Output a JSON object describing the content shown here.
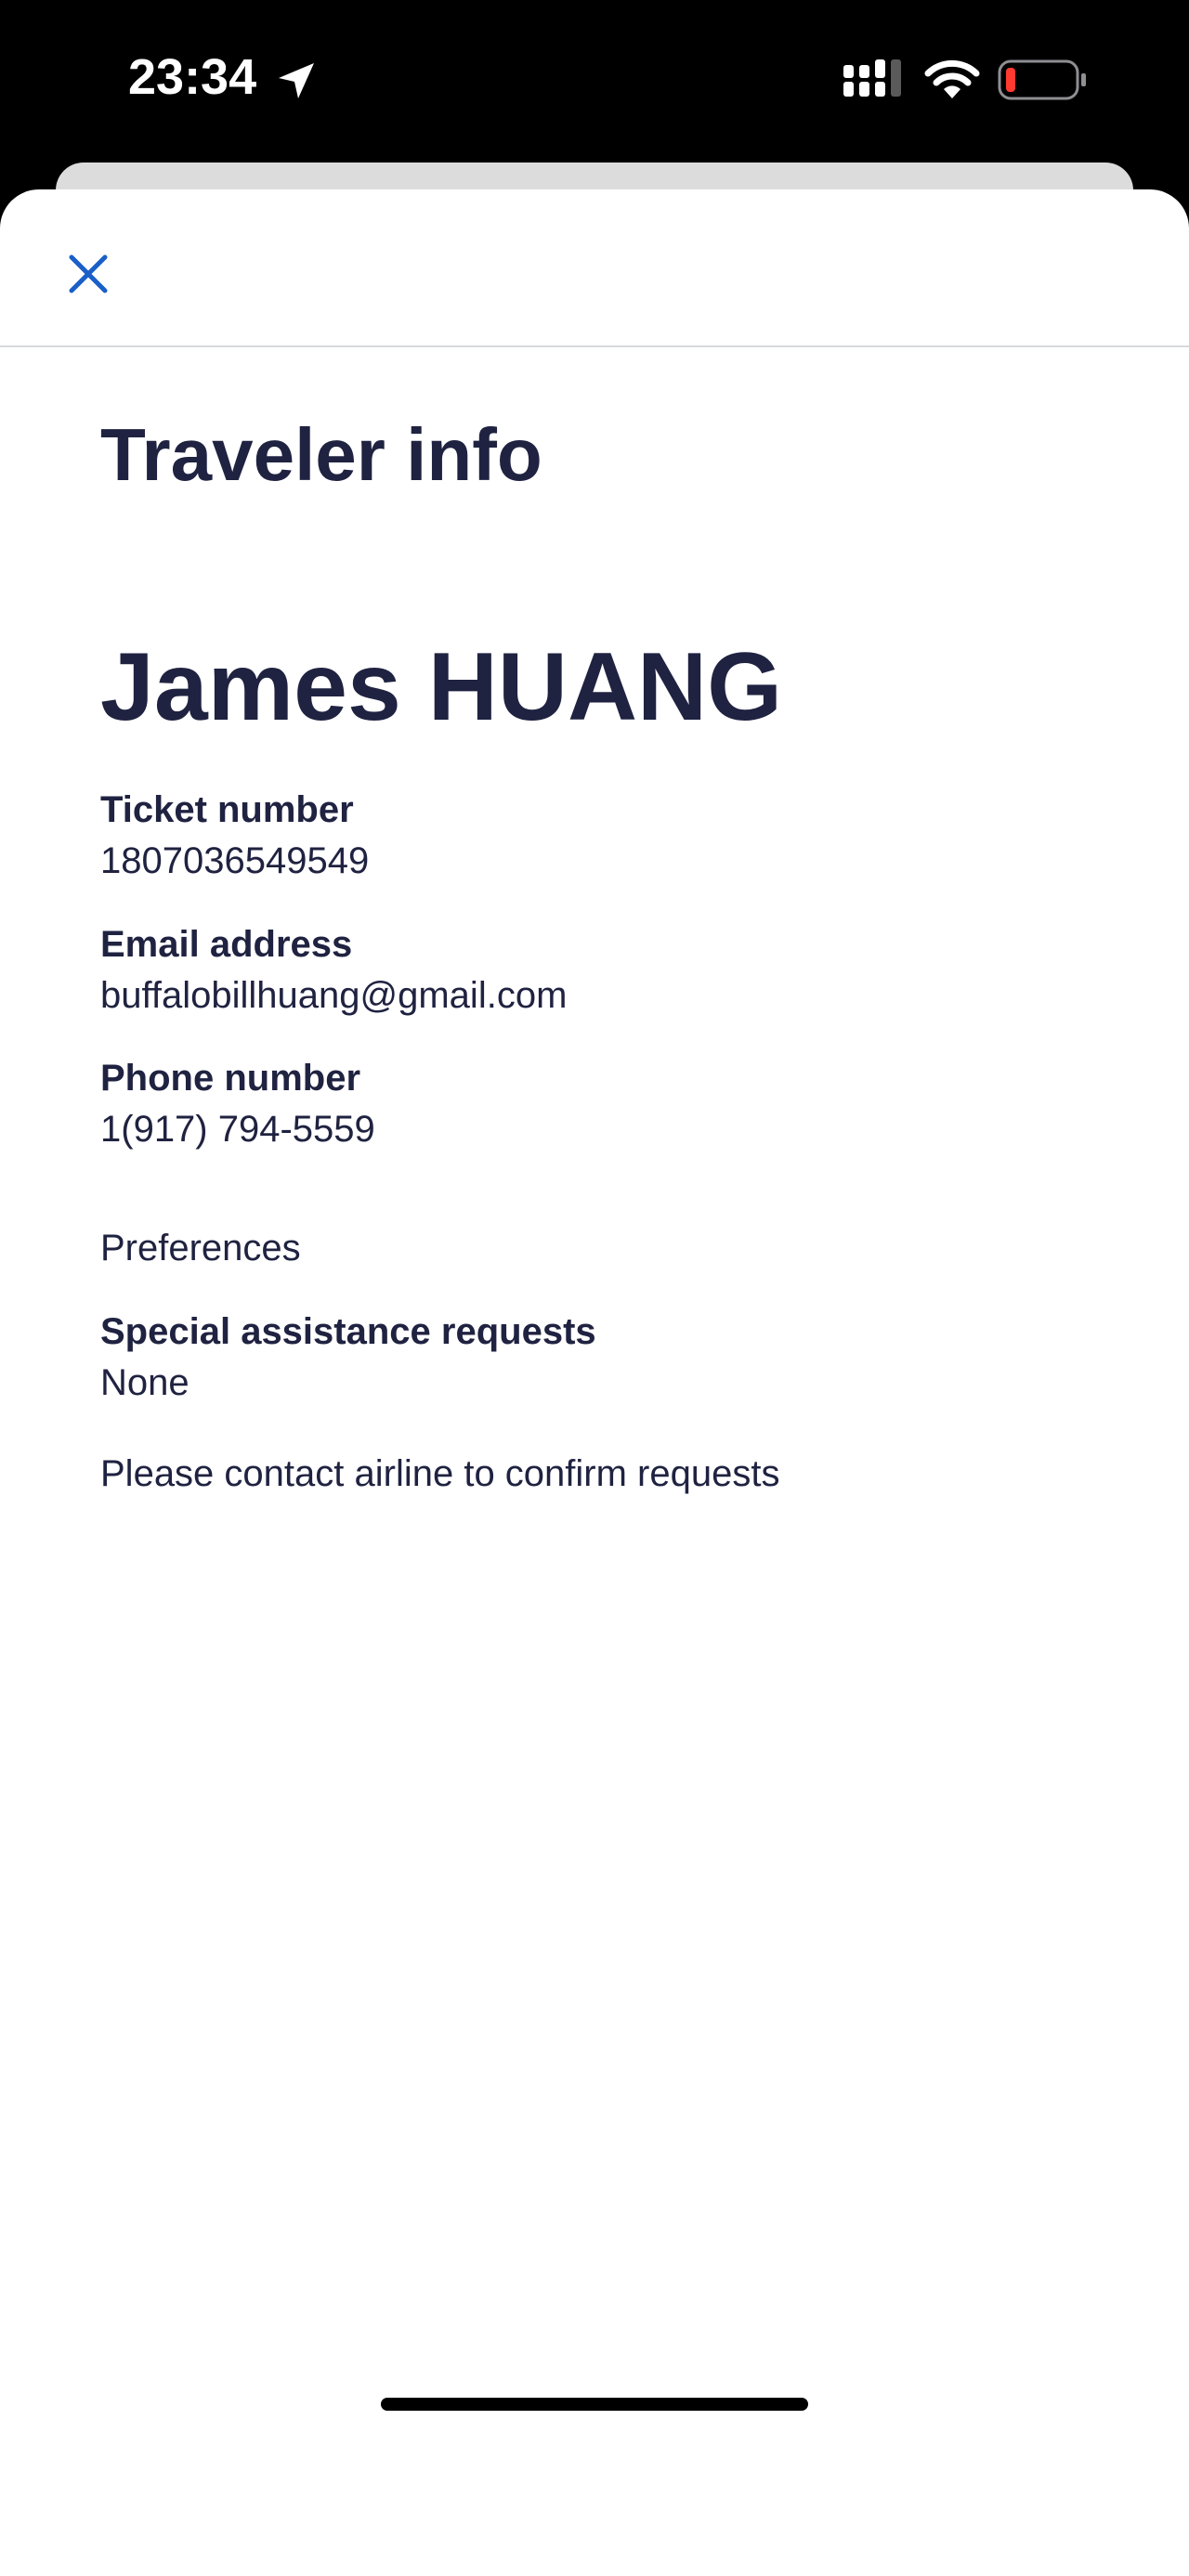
{
  "status_bar": {
    "time": "23:34",
    "icons": [
      "location-arrow-icon",
      "cellular-signal-icon",
      "wifi-icon",
      "battery-low-icon"
    ],
    "battery_color": "#ff3b30"
  },
  "header": {
    "close_icon": "close-icon",
    "accent_color": "#1a5fc8"
  },
  "page": {
    "title": "Traveler info"
  },
  "traveler": {
    "name": "James HUANG",
    "ticket": {
      "label": "Ticket number",
      "value": "1807036549549"
    },
    "email": {
      "label": "Email address",
      "value": "buffalobillhuang@gmail.com"
    },
    "phone": {
      "label": "Phone number",
      "value": "1(917) 794-5559"
    }
  },
  "preferences": {
    "heading": "Preferences",
    "special_assistance": {
      "label": "Special assistance requests",
      "value": "None"
    },
    "note": "Please contact airline to confirm requests"
  },
  "colors": {
    "text": "#1f2240",
    "divider": "#d7d9de",
    "background": "#ffffff"
  }
}
